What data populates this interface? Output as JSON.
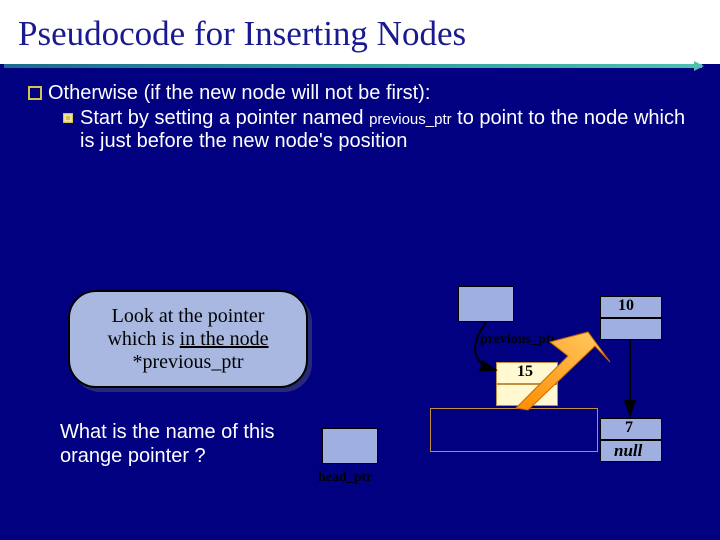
{
  "title": "Pseudocode for Inserting Nodes",
  "bullet1": "Otherwise (if the new node will not be first):",
  "subbullet_part1": "Start by setting a pointer named ",
  "subbullet_mono": "previous_ptr",
  "subbullet_part2": " to point to the node which is just before the new node's position",
  "callout_line1": "Look at the pointer",
  "callout_line2a": "which is ",
  "callout_line2b": "in the node",
  "callout_line3": "*previous_ptr",
  "question": "What is the name of this orange pointer ?",
  "labels": {
    "previous_ptr": "previous_ptr",
    "head_ptr": "head_ptr",
    "ten": "10",
    "fifteen": "15",
    "seven": "7",
    "null": "null"
  }
}
